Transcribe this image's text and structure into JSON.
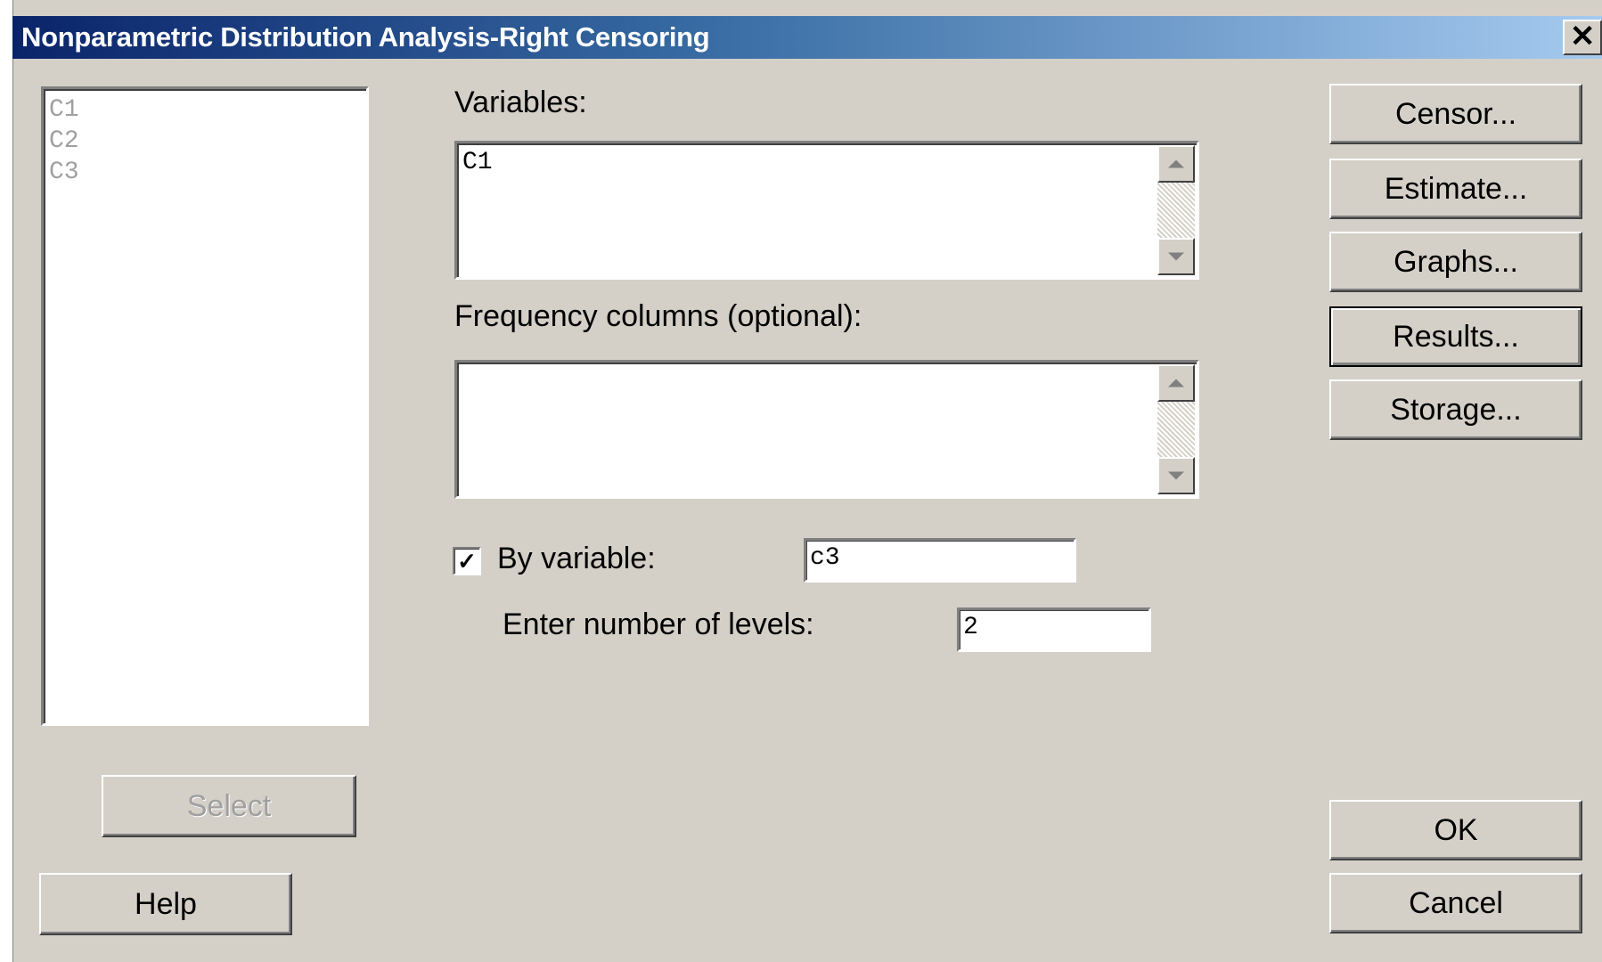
{
  "window": {
    "title": "Nonparametric Distribution Analysis-Right Censoring",
    "close_glyph": "✕"
  },
  "column_list": {
    "items": [
      "C1",
      "C2",
      "C3"
    ]
  },
  "variables": {
    "label": "Variables:",
    "value": "C1"
  },
  "frequency": {
    "label": "Frequency columns (optional):",
    "value": ""
  },
  "by_variable": {
    "checked": true,
    "check_glyph": "✓",
    "label": "By variable:",
    "value": "c3"
  },
  "levels": {
    "label": "Enter number of levels:",
    "value": "2"
  },
  "buttons": {
    "censor": "Censor...",
    "estimate": "Estimate...",
    "graphs": "Graphs...",
    "results": "Results...",
    "storage": "Storage...",
    "select": "Select",
    "help": "Help",
    "ok": "OK",
    "cancel": "Cancel"
  }
}
